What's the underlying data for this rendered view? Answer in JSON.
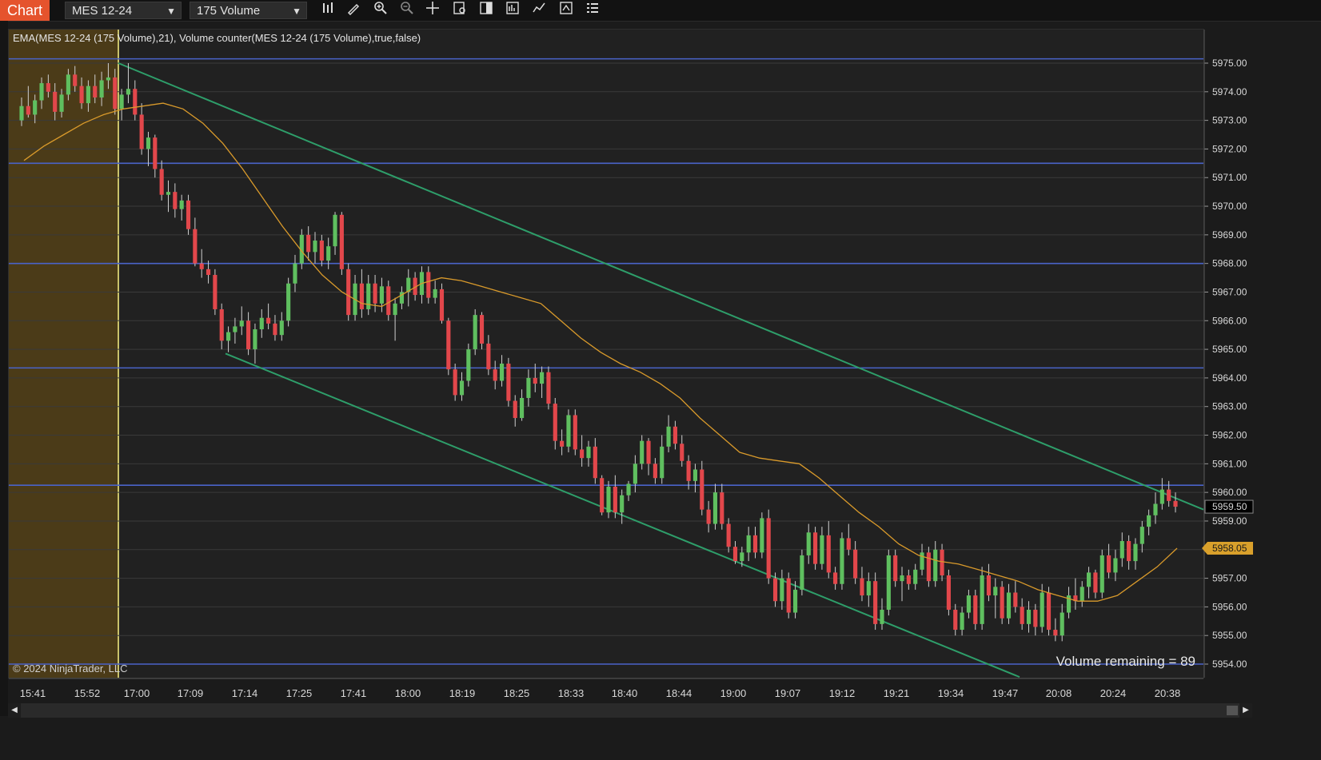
{
  "toolbar": {
    "tab_label": "Chart",
    "instrument": "MES 12-24",
    "interval": "175 Volume",
    "tools": [
      "bar-type-icon",
      "drawing-pencil-icon",
      "zoom-in-icon",
      "zoom-out-icon",
      "crosshair-icon",
      "data-box-icon",
      "chart-trader-icon",
      "properties-icon",
      "indicators-icon",
      "strategy-icon",
      "object-list-icon"
    ]
  },
  "legend": "EMA(MES 12-24 (175 Volume),21), Volume counter(MES 12-24 (175 Volume),true,false)",
  "copyright": "© 2024 NinjaTrader, LLC",
  "volume_remaining": "Volume remaining = 89",
  "colors": {
    "up": "#5fbf5f",
    "down": "#e2474b",
    "ema": "#d99a2b",
    "hline": "#4a63c9",
    "trend": "#2e9e6a",
    "session_shade": "#4b3b18",
    "session_line": "#c9c26a",
    "last_price_bg": "#000000",
    "ema_label_bg": "#d9a02b"
  },
  "chart_data": {
    "type": "candlestick",
    "instrument": "MES 12-24",
    "y_axis_ticks": [
      "5975.00",
      "5974.00",
      "5973.00",
      "5972.00",
      "5971.00",
      "5970.00",
      "5969.00",
      "5968.00",
      "5967.00",
      "5966.00",
      "5965.00",
      "5964.00",
      "5963.00",
      "5962.00",
      "5961.00",
      "5960.00",
      "5959.00",
      "5958.00",
      "5957.00",
      "5956.00",
      "5955.00",
      "5954.00"
    ],
    "x_axis_ticks": [
      "15:41",
      "15:52",
      "17:00",
      "17:09",
      "17:14",
      "17:25",
      "17:41",
      "18:00",
      "18:19",
      "18:25",
      "18:33",
      "18:40",
      "18:44",
      "19:00",
      "19:07",
      "19:12",
      "19:21",
      "19:34",
      "19:47",
      "20:08",
      "20:24",
      "20:38"
    ],
    "ylim": [
      5953.5,
      5975.6
    ],
    "last_price": "5959.50",
    "ema_value": "5958.05",
    "horizontal_lines": [
      5975.15,
      5971.5,
      5968.0,
      5964.35,
      5960.25,
      5954.0
    ],
    "trend_lines": [
      {
        "name": "upper",
        "from": {
          "bar": 0,
          "price": 5975.0
        },
        "to": {
          "bar": 240,
          "price": 5959.4
        }
      },
      {
        "name": "lower",
        "from": {
          "bar": 26,
          "price": 5964.9
        },
        "to": {
          "bar": 200,
          "price": 5953.5
        }
      }
    ],
    "candles": [
      [
        5973,
        5973.8,
        5972.8,
        5973.5
      ],
      [
        5973.5,
        5974.2,
        5973.1,
        5973.2
      ],
      [
        5973.2,
        5973.9,
        5972.9,
        5973.7
      ],
      [
        5973.7,
        5974.5,
        5973.4,
        5974.3
      ],
      [
        5974.3,
        5974.6,
        5973.8,
        5974.0
      ],
      [
        5974.0,
        5974.3,
        5973.0,
        5973.3
      ],
      [
        5973.3,
        5974.1,
        5973.1,
        5973.9
      ],
      [
        5973.9,
        5974.8,
        5973.7,
        5974.6
      ],
      [
        5974.6,
        5974.9,
        5974.0,
        5974.2
      ],
      [
        5974.2,
        5974.5,
        5973.4,
        5973.6
      ],
      [
        5973.6,
        5974.4,
        5973.3,
        5974.2
      ],
      [
        5974.2,
        5974.6,
        5973.6,
        5973.8
      ],
      [
        5973.8,
        5974.7,
        5973.5,
        5974.4
      ],
      [
        5974.4,
        5975.0,
        5974.1,
        5974.5
      ],
      [
        5974.5,
        5974.8,
        5973.2,
        5973.4
      ],
      [
        5973.4,
        5974.1,
        5973.0,
        5973.9
      ],
      [
        5973.9,
        5975.0,
        5973.6,
        5974.1
      ],
      [
        5974.1,
        5974.4,
        5973.0,
        5973.2
      ],
      [
        5973.2,
        5973.6,
        5971.8,
        5972.0
      ],
      [
        5972.0,
        5972.6,
        5971.4,
        5972.4
      ],
      [
        5972.4,
        5972.5,
        5971.0,
        5971.3
      ],
      [
        5971.3,
        5971.6,
        5970.2,
        5970.4
      ],
      [
        5970.4,
        5970.9,
        5969.8,
        5970.5
      ],
      [
        5970.5,
        5970.8,
        5969.6,
        5969.9
      ],
      [
        5969.9,
        5970.4,
        5969.5,
        5970.2
      ],
      [
        5970.2,
        5970.4,
        5969.0,
        5969.2
      ],
      [
        5969.2,
        5969.6,
        5967.9,
        5968.0
      ],
      [
        5968.0,
        5968.5,
        5967.5,
        5967.8
      ],
      [
        5967.8,
        5968.1,
        5967.3,
        5967.6
      ],
      [
        5967.6,
        5967.8,
        5966.2,
        5966.4
      ],
      [
        5966.4,
        5966.6,
        5965.0,
        5965.3
      ],
      [
        5965.3,
        5965.8,
        5964.9,
        5965.6
      ],
      [
        5965.6,
        5966.1,
        5965.2,
        5965.8
      ],
      [
        5965.8,
        5966.5,
        5965.5,
        5966.0
      ],
      [
        5966.0,
        5966.3,
        5964.8,
        5965.0
      ],
      [
        5965.0,
        5965.9,
        5964.5,
        5965.7
      ],
      [
        5965.7,
        5966.4,
        5965.4,
        5966.1
      ],
      [
        5966.1,
        5966.6,
        5965.7,
        5965.9
      ],
      [
        5965.9,
        5966.2,
        5965.3,
        5965.5
      ],
      [
        5965.5,
        5966.3,
        5965.3,
        5966.0
      ],
      [
        5966.0,
        5967.5,
        5965.8,
        5967.3
      ],
      [
        5967.3,
        5968.3,
        5967.0,
        5968.0
      ],
      [
        5968.0,
        5969.2,
        5967.8,
        5969.0
      ],
      [
        5969.0,
        5969.3,
        5968.1,
        5968.4
      ],
      [
        5968.4,
        5969.1,
        5968.0,
        5968.8
      ],
      [
        5968.8,
        5969.0,
        5967.9,
        5968.1
      ],
      [
        5968.1,
        5968.9,
        5967.8,
        5968.6
      ],
      [
        5968.6,
        5969.8,
        5968.3,
        5969.7
      ],
      [
        5969.7,
        5969.8,
        5967.6,
        5967.8
      ],
      [
        5967.8,
        5968.0,
        5966.0,
        5966.2
      ],
      [
        5966.2,
        5967.6,
        5966.0,
        5967.3
      ],
      [
        5967.3,
        5967.8,
        5966.1,
        5966.4
      ],
      [
        5966.4,
        5967.6,
        5966.2,
        5967.3
      ],
      [
        5967.3,
        5967.6,
        5966.3,
        5966.6
      ],
      [
        5966.6,
        5967.5,
        5966.3,
        5967.2
      ],
      [
        5967.2,
        5967.4,
        5966.0,
        5966.2
      ],
      [
        5966.2,
        5966.8,
        5965.3,
        5966.6
      ],
      [
        5966.6,
        5967.2,
        5966.4,
        5967.0
      ],
      [
        5967.0,
        5967.8,
        5966.5,
        5967.5
      ],
      [
        5967.5,
        5967.7,
        5966.7,
        5966.9
      ],
      [
        5966.9,
        5967.9,
        5966.6,
        5967.7
      ],
      [
        5967.7,
        5967.9,
        5966.6,
        5966.8
      ],
      [
        5966.8,
        5967.4,
        5966.6,
        5967.1
      ],
      [
        5967.1,
        5967.3,
        5965.9,
        5966.0
      ],
      [
        5966.0,
        5966.1,
        5964.1,
        5964.3
      ],
      [
        5964.3,
        5964.5,
        5963.2,
        5963.4
      ],
      [
        5963.4,
        5964.2,
        5963.2,
        5963.9
      ],
      [
        5963.9,
        5965.2,
        5963.7,
        5965.0
      ],
      [
        5965.0,
        5966.4,
        5964.8,
        5966.2
      ],
      [
        5966.2,
        5966.3,
        5965.0,
        5965.2
      ],
      [
        5965.2,
        5965.5,
        5964.1,
        5964.3
      ],
      [
        5964.3,
        5964.6,
        5963.6,
        5963.9
      ],
      [
        5963.9,
        5964.8,
        5963.7,
        5964.5
      ],
      [
        5964.5,
        5964.7,
        5963.0,
        5963.2
      ],
      [
        5963.2,
        5963.4,
        5962.3,
        5962.6
      ],
      [
        5962.6,
        5963.6,
        5962.5,
        5963.3
      ],
      [
        5963.3,
        5964.3,
        5963.0,
        5964.0
      ],
      [
        5964.0,
        5964.5,
        5963.5,
        5963.8
      ],
      [
        5963.8,
        5964.4,
        5963.3,
        5964.2
      ],
      [
        5964.2,
        5964.4,
        5962.9,
        5963.1
      ],
      [
        5963.1,
        5963.3,
        5961.5,
        5961.8
      ],
      [
        5961.8,
        5962.2,
        5961.3,
        5961.6
      ],
      [
        5961.6,
        5962.9,
        5961.4,
        5962.7
      ],
      [
        5962.7,
        5962.9,
        5961.3,
        5961.5
      ],
      [
        5961.5,
        5962.0,
        5960.9,
        5961.2
      ],
      [
        5961.2,
        5961.8,
        5960.9,
        5961.6
      ],
      [
        5961.6,
        5961.9,
        5960.3,
        5960.5
      ],
      [
        5960.5,
        5960.6,
        5959.2,
        5959.3
      ],
      [
        5959.3,
        5960.4,
        5959.1,
        5960.2
      ],
      [
        5960.2,
        5960.6,
        5959.1,
        5959.3
      ],
      [
        5959.3,
        5960.1,
        5958.9,
        5959.9
      ],
      [
        5959.9,
        5960.4,
        5959.7,
        5960.3
      ],
      [
        5960.3,
        5961.3,
        5960.0,
        5961.0
      ],
      [
        5961.0,
        5962.0,
        5960.8,
        5961.8
      ],
      [
        5961.8,
        5961.9,
        5960.6,
        5961.0
      ],
      [
        5961.0,
        5961.2,
        5960.3,
        5960.5
      ],
      [
        5960.5,
        5962.0,
        5960.3,
        5961.6
      ],
      [
        5961.6,
        5962.7,
        5961.4,
        5962.3
      ],
      [
        5962.3,
        5962.5,
        5961.5,
        5961.7
      ],
      [
        5961.7,
        5962.0,
        5960.9,
        5961.1
      ],
      [
        5961.1,
        5961.3,
        5960.1,
        5960.4
      ],
      [
        5960.4,
        5961.0,
        5960.0,
        5960.8
      ],
      [
        5960.8,
        5961.1,
        5959.2,
        5959.4
      ],
      [
        5959.4,
        5959.7,
        5958.6,
        5958.9
      ],
      [
        5958.9,
        5960.3,
        5958.7,
        5960.0
      ],
      [
        5960.0,
        5960.3,
        5958.7,
        5958.9
      ],
      [
        5958.9,
        5959.1,
        5957.9,
        5958.1
      ],
      [
        5958.1,
        5958.3,
        5957.5,
        5957.6
      ],
      [
        5957.6,
        5958.1,
        5957.4,
        5957.9
      ],
      [
        5957.9,
        5958.8,
        5957.6,
        5958.5
      ],
      [
        5958.5,
        5958.8,
        5957.7,
        5957.9
      ],
      [
        5957.9,
        5959.3,
        5957.7,
        5959.1
      ],
      [
        5959.1,
        5959.4,
        5956.8,
        5957.0
      ],
      [
        5957.0,
        5957.2,
        5956.0,
        5956.2
      ],
      [
        5956.2,
        5957.3,
        5955.9,
        5957.0
      ],
      [
        5957.0,
        5957.2,
        5955.6,
        5955.8
      ],
      [
        5955.8,
        5956.9,
        5955.6,
        5956.6
      ],
      [
        5956.6,
        5958.0,
        5956.4,
        5957.8
      ],
      [
        5957.8,
        5958.9,
        5957.5,
        5958.6
      ],
      [
        5958.6,
        5958.8,
        5957.3,
        5957.5
      ],
      [
        5957.5,
        5958.8,
        5957.3,
        5958.5
      ],
      [
        5958.5,
        5959.0,
        5957.0,
        5957.2
      ],
      [
        5957.2,
        5957.4,
        5956.6,
        5956.8
      ],
      [
        5956.8,
        5958.6,
        5956.6,
        5958.4
      ],
      [
        5958.4,
        5958.9,
        5957.8,
        5958.0
      ],
      [
        5958.0,
        5958.3,
        5956.8,
        5957.0
      ],
      [
        5957.0,
        5957.4,
        5956.2,
        5956.4
      ],
      [
        5956.4,
        5957.2,
        5956.0,
        5956.9
      ],
      [
        5956.9,
        5957.2,
        5955.2,
        5955.4
      ],
      [
        5955.4,
        5956.3,
        5955.2,
        5955.9
      ],
      [
        5955.9,
        5958.0,
        5955.7,
        5957.8
      ],
      [
        5957.8,
        5958.0,
        5956.7,
        5956.9
      ],
      [
        5956.9,
        5957.4,
        5956.2,
        5957.1
      ],
      [
        5957.1,
        5957.3,
        5956.6,
        5956.8
      ],
      [
        5956.8,
        5957.5,
        5956.6,
        5957.3
      ],
      [
        5957.3,
        5958.2,
        5957.1,
        5957.9
      ],
      [
        5957.9,
        5958.1,
        5956.7,
        5956.9
      ],
      [
        5956.9,
        5958.3,
        5956.7,
        5958.0
      ],
      [
        5958.0,
        5958.2,
        5956.9,
        5957.1
      ],
      [
        5957.1,
        5957.3,
        5955.7,
        5955.9
      ],
      [
        5955.9,
        5956.1,
        5955.0,
        5955.2
      ],
      [
        5955.2,
        5956.0,
        5955.0,
        5955.8
      ],
      [
        5955.8,
        5956.6,
        5955.6,
        5956.4
      ],
      [
        5956.4,
        5956.6,
        5955.2,
        5955.4
      ],
      [
        5955.4,
        5957.4,
        5955.2,
        5957.1
      ],
      [
        5957.1,
        5957.5,
        5956.2,
        5956.4
      ],
      [
        5956.4,
        5957.0,
        5955.6,
        5956.7
      ],
      [
        5956.7,
        5956.9,
        5955.4,
        5955.6
      ],
      [
        5955.6,
        5956.8,
        5955.4,
        5956.5
      ],
      [
        5956.5,
        5956.9,
        5955.8,
        5956.0
      ],
      [
        5956.0,
        5956.3,
        5955.2,
        5955.4
      ],
      [
        5955.4,
        5956.2,
        5955.1,
        5955.9
      ],
      [
        5955.9,
        5956.1,
        5955.0,
        5955.3
      ],
      [
        5955.3,
        5956.8,
        5955.1,
        5956.5
      ],
      [
        5956.5,
        5956.7,
        5955.0,
        5955.2
      ],
      [
        5955.2,
        5955.6,
        5954.8,
        5955.0
      ],
      [
        5955.0,
        5956.1,
        5954.8,
        5955.8
      ],
      [
        5955.8,
        5956.7,
        5955.6,
        5956.4
      ],
      [
        5956.4,
        5957.0,
        5955.9,
        5956.2
      ],
      [
        5956.2,
        5956.9,
        5956.0,
        5956.7
      ],
      [
        5956.7,
        5957.4,
        5956.3,
        5957.2
      ],
      [
        5957.2,
        5957.3,
        5956.3,
        5956.5
      ],
      [
        5956.5,
        5958.0,
        5956.3,
        5957.8
      ],
      [
        5957.8,
        5958.2,
        5957.0,
        5957.2
      ],
      [
        5957.2,
        5958.0,
        5956.9,
        5957.7
      ],
      [
        5957.7,
        5958.6,
        5957.4,
        5958.3
      ],
      [
        5958.3,
        5958.5,
        5957.3,
        5957.6
      ],
      [
        5957.6,
        5958.4,
        5957.3,
        5958.2
      ],
      [
        5958.2,
        5959.0,
        5957.9,
        5958.8
      ],
      [
        5958.8,
        5959.4,
        5958.5,
        5959.2
      ],
      [
        5959.2,
        5960.0,
        5958.9,
        5959.6
      ],
      [
        5959.6,
        5960.5,
        5959.4,
        5960.1
      ],
      [
        5960.1,
        5960.4,
        5959.5,
        5959.7
      ],
      [
        5959.7,
        5960.0,
        5959.3,
        5959.5
      ]
    ],
    "ema": [
      5971.6,
      5972.1,
      5972.5,
      5972.9,
      5973.2,
      5973.4,
      5973.5,
      5973.6,
      5973.4,
      5972.9,
      5972.2,
      5971.3,
      5970.3,
      5969.3,
      5968.4,
      5967.6,
      5967.0,
      5966.6,
      5966.5,
      5966.9,
      5967.3,
      5967.5,
      5967.4,
      5967.2,
      5967.0,
      5966.8,
      5966.6,
      5966.0,
      5965.4,
      5964.9,
      5964.5,
      5964.2,
      5963.8,
      5963.3,
      5962.6,
      5962.0,
      5961.4,
      5961.2,
      5961.1,
      5961.0,
      5960.5,
      5959.9,
      5959.3,
      5958.8,
      5958.2,
      5957.8,
      5957.6,
      5957.5,
      5957.3,
      5957.1,
      5956.9,
      5956.6,
      5956.4,
      5956.2,
      5956.2,
      5956.4,
      5956.9,
      5957.4,
      5958.05
    ]
  }
}
